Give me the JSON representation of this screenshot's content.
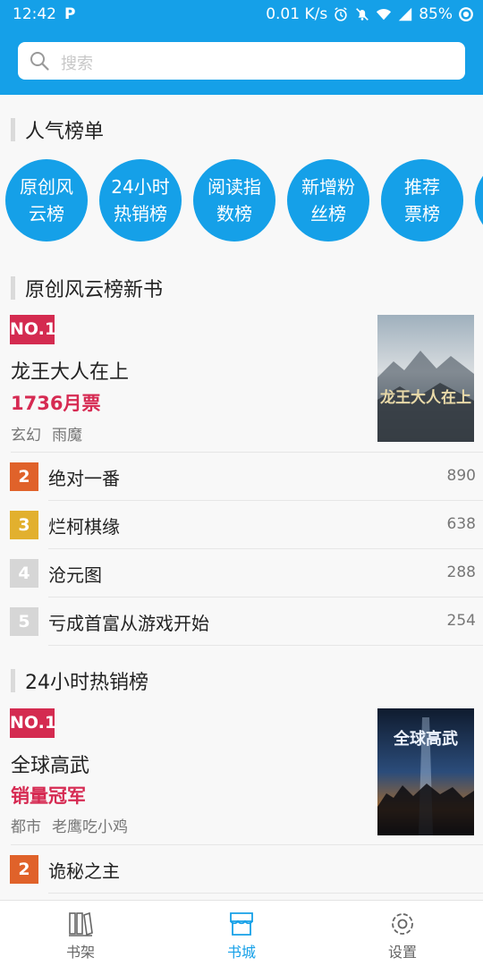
{
  "status_bar": {
    "time": "12:42",
    "network_speed": "0.01 K/s",
    "battery": "85%"
  },
  "search": {
    "placeholder": "搜索"
  },
  "popular": {
    "title": "人气榜单",
    "circles": [
      {
        "line1": "原创风",
        "line2": "云榜"
      },
      {
        "line1": "24小时",
        "line2": "热销榜"
      },
      {
        "line1": "阅读指",
        "line2": "数榜"
      },
      {
        "line1": "新增粉",
        "line2": "丝榜"
      },
      {
        "line1": "推荐",
        "line2": "票榜"
      }
    ]
  },
  "sections": [
    {
      "title": "原创风云榜新书",
      "top": {
        "badge": "NO.1",
        "title": "龙王大人在上",
        "metric": "1736月票",
        "genre": "玄幻",
        "author": "雨魔",
        "cover_text": "龙王大人在上"
      },
      "items": [
        {
          "rank": "2",
          "name": "绝对一番",
          "count": "890",
          "color": "#e0622a"
        },
        {
          "rank": "3",
          "name": "烂柯棋缘",
          "count": "638",
          "color": "#e2b02e"
        },
        {
          "rank": "4",
          "name": "沧元图",
          "count": "288",
          "color": "#d6d6d6"
        },
        {
          "rank": "5",
          "name": "亏成首富从游戏开始",
          "count": "254",
          "color": "#d6d6d6"
        }
      ]
    },
    {
      "title": "24小时热销榜",
      "top": {
        "badge": "NO.1",
        "title": "全球高武",
        "metric": "销量冠军",
        "genre": "都市",
        "author": "老鹰吃小鸡",
        "cover_text": "全球高武"
      },
      "items": [
        {
          "rank": "2",
          "name": "诡秘之主",
          "count": "",
          "color": "#e0622a"
        }
      ]
    }
  ],
  "bottom_nav": {
    "items": [
      {
        "label": "书架",
        "icon": "bookshelf-icon",
        "active": false
      },
      {
        "label": "书城",
        "icon": "bookstore-icon",
        "active": true
      },
      {
        "label": "设置",
        "icon": "settings-icon",
        "active": false
      }
    ],
    "active_color": "#15a0e8",
    "inactive_color": "#666666"
  }
}
